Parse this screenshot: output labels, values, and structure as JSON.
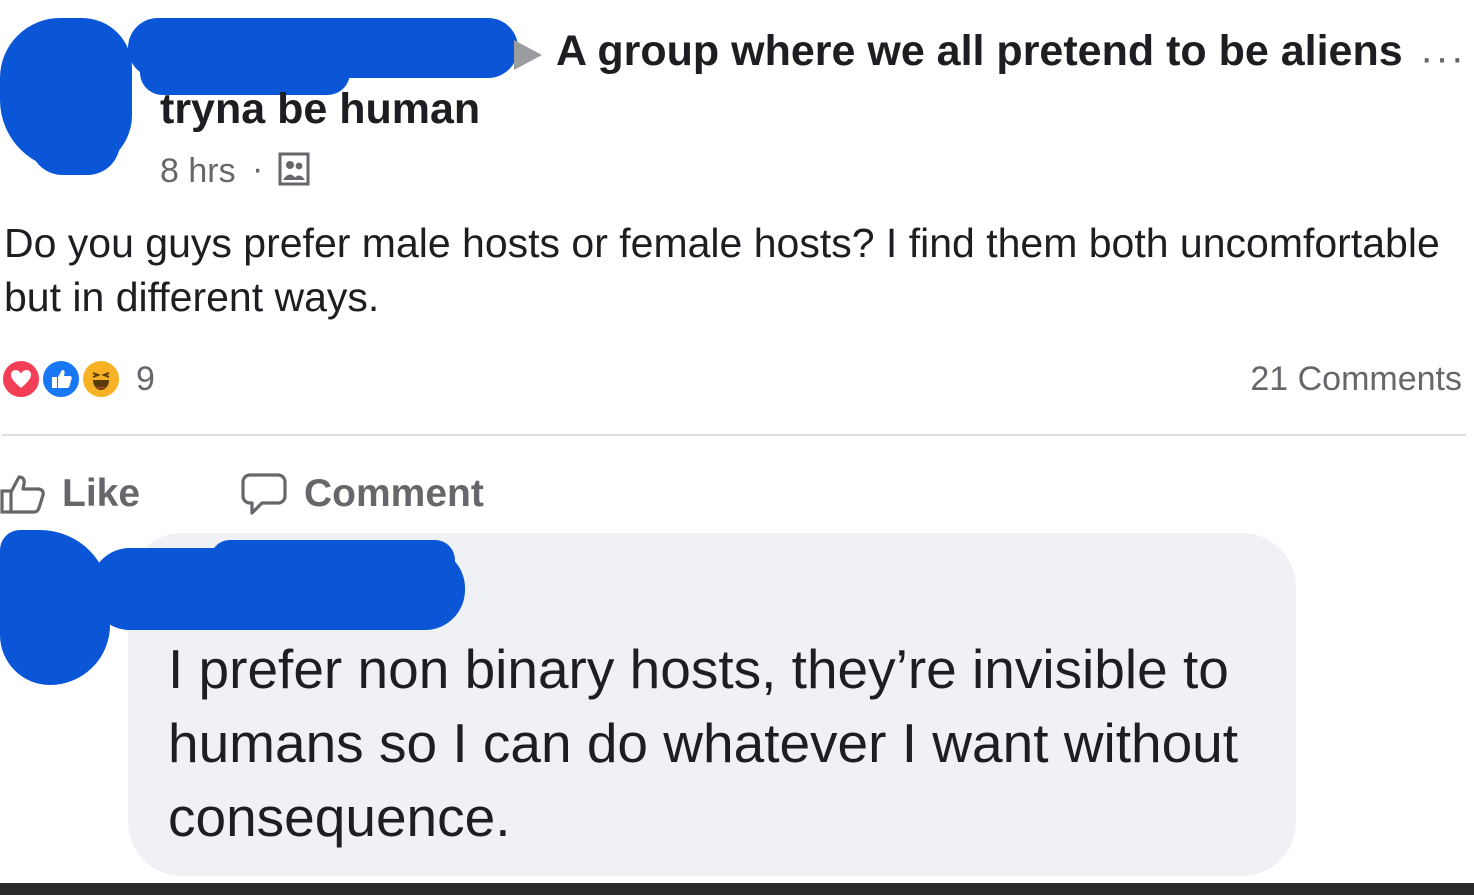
{
  "post": {
    "group_name": "A group where we all pretend to be aliens",
    "author_name": "tryna be human",
    "timestamp": "8 hrs",
    "separator": "·",
    "more_label": "···",
    "text": "Do you guys prefer male hosts or female hosts? I find them both uncomfortable but in different ways."
  },
  "reactions": {
    "types": [
      "love",
      "like",
      "haha"
    ],
    "count": "9",
    "comments": "21 Comments"
  },
  "actions": {
    "like_label": "Like",
    "comment_label": "Comment"
  },
  "comment": {
    "text": "I prefer non binary hosts, they’re invisible to humans so I can do whatever I want without consequence."
  },
  "colors": {
    "redaction": "#0a56d6",
    "bubble": "#eff1f5",
    "secondary_text": "#65676b",
    "love": "#f33e58",
    "like": "#1877f2",
    "haha": "#f7b125"
  },
  "icons": [
    "arrow-right-icon",
    "more-icon",
    "group-privacy-icon",
    "love-reaction-icon",
    "like-reaction-icon",
    "haha-reaction-icon",
    "thumbs-up-icon",
    "comment-icon"
  ]
}
